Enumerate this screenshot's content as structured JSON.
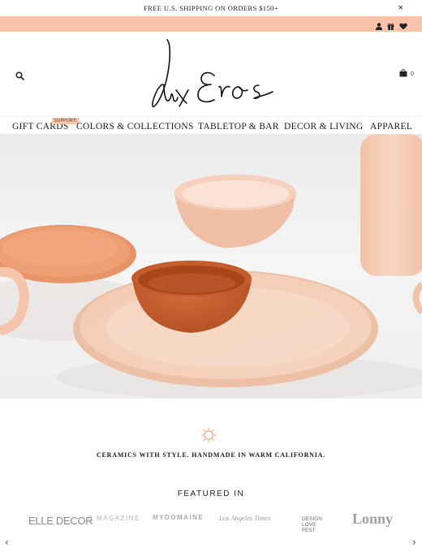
{
  "announcement": {
    "text": "FREE U.S. SHIPPING ON ORDERS $150+",
    "close": "×"
  },
  "account_icons": [
    "user-icon",
    "gift-icon",
    "heart-icon"
  ],
  "brand": {
    "logo_text": "lux Eros"
  },
  "cart": {
    "count": "0"
  },
  "nav": {
    "gift_cards": "GIFT CARDS",
    "gift_badge": "SUPPORT!",
    "colors": "COLORS & COLLECTIONS",
    "tabletop": "TABLETOP & BAR",
    "decor": "DECOR & LIVING",
    "apparel": "APPAREL"
  },
  "tagline": "CERAMICS WITH STYLE. HANDMADE IN WARM CALIFORNIA.",
  "featured": {
    "heading": "FEATURED IN",
    "logos": [
      "ELLE DECOR",
      "C MAGAZINE",
      "MYDOMAINE",
      "Los Angeles Times",
      "DESIGN LOVE FEST",
      "Lonny"
    ]
  },
  "carousel": {
    "prev": "‹",
    "next": "›"
  },
  "colors": {
    "accent_bar": "#f8c3a8",
    "text": "#1b1b1b",
    "press_gray": "#9e9e9e"
  }
}
